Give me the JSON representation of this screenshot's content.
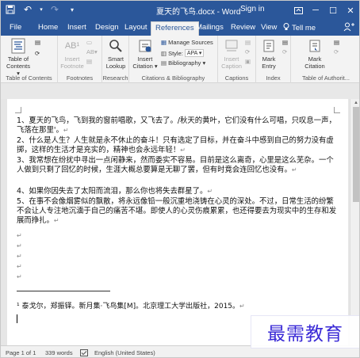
{
  "window": {
    "title": "夏天的飞鸟.docx - Word",
    "signin": "Sign in"
  },
  "tabs": [
    {
      "label": "File"
    },
    {
      "label": "Home"
    },
    {
      "label": "Insert"
    },
    {
      "label": "Design"
    },
    {
      "label": "Layout"
    },
    {
      "label": "References"
    },
    {
      "label": "Mailings"
    },
    {
      "label": "Review"
    },
    {
      "label": "View"
    }
  ],
  "tellme": "Tell me",
  "ribbon": {
    "toc": {
      "btn": "Table of Contents ▾",
      "group": "Table of Contents"
    },
    "footnotes": {
      "insert_label": "Insert Footnote",
      "ab_label": "AB¹",
      "group": "Footnotes"
    },
    "research": {
      "smart_lookup": "Smart Lookup",
      "group": "Research"
    },
    "citations": {
      "insert_citation": "Insert Citation ▾",
      "manage_sources": "Manage Sources",
      "style_label": "Style:",
      "style_value": "APA",
      "bibliography": "Bibliography ▾",
      "group": "Citations & Bibliography"
    },
    "captions": {
      "insert_caption": "Insert Caption",
      "group": "Captions"
    },
    "index": {
      "mark_entry": "Mark Entry",
      "group": "Index"
    },
    "toa": {
      "mark_citation": "Mark Citation",
      "group": "Table of Authorit..."
    }
  },
  "document": {
    "paragraphs": [
      "1、夏天的飞鸟，飞到我的窗前唱歌，又飞去了。/秋天的黄叶，它们没有什么可唱，只叹息一声，飞落在那里'。",
      "2、什么是人生？人生就是永不休止的奋斗！只有选定了目标，并在奋斗中感到自己的努力没有虚掷，这样的生活才是充实的，精神也会永远年轻！",
      "3、我常想在纷扰中寻出一点闲静来，然而委实不容易。目前是这么离奇，心里是这么芜杂。一个人做到只剩了回忆的时候，生涯大概总要算是无聊了罢，但有时竟会连回忆也没有。",
      "4、如果你因失去了太阳而流泪，那么你也将失去群星了。",
      "5、在事不会像烟雾似的飘散，将永远像铅一般沉重地浇铸在心灵的深处。不过，日常生活的纷繁不会让人专注地沉湎于自己的痛苦不堪。即使人的心灵伤痕累累，也还得要去为现实中的生存和发展而挣扎。"
    ],
    "footnote": "¹ 泰戈尔，郑振铎。新月集·飞鸟集[M]。北京理工大学出版社，2015。",
    "para_mark": "↵"
  },
  "status": {
    "page": "Page 1 of 1",
    "words": "339 words",
    "language": "English (United States)"
  },
  "watermark": "最需教育",
  "colors": {
    "accent": "#2b579a",
    "watermark": "#3a2ad6"
  }
}
